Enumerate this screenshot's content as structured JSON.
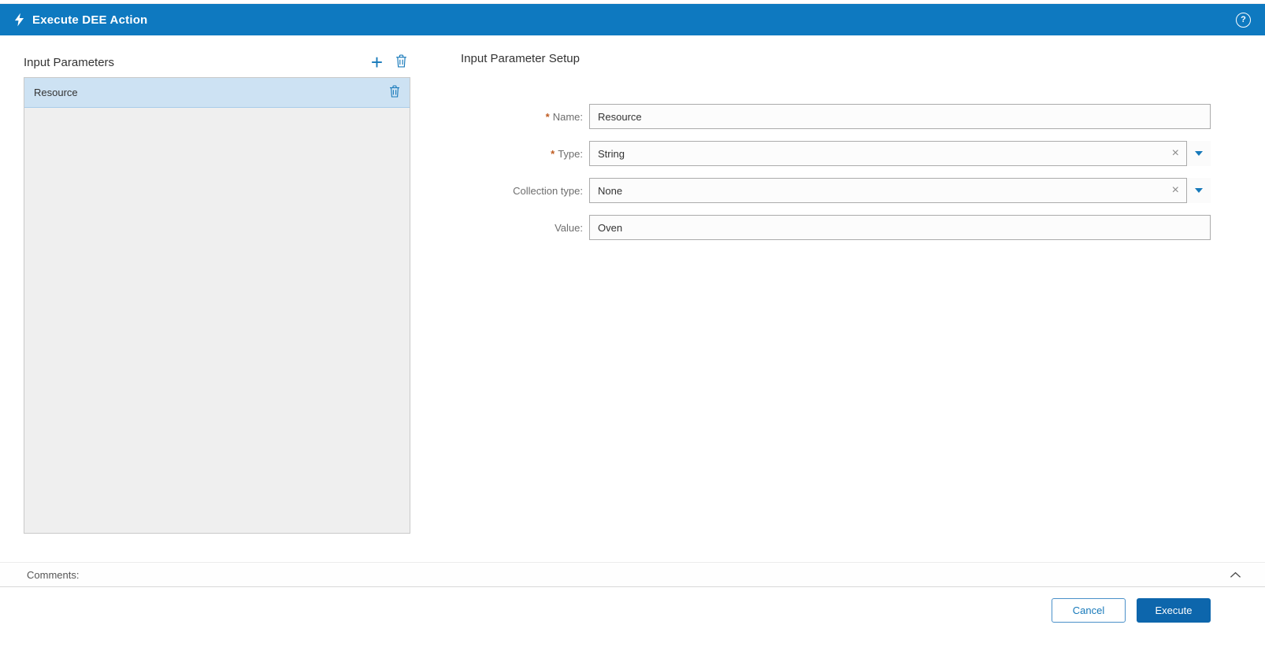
{
  "header": {
    "title": "Execute DEE Action"
  },
  "left_panel": {
    "title": "Input Parameters",
    "items": [
      {
        "label": "Resource",
        "selected": true
      }
    ]
  },
  "right_panel": {
    "title": "Input Parameter Setup",
    "fields": {
      "name": {
        "label": "Name:",
        "required_marker": "*",
        "value": "Resource"
      },
      "type": {
        "label": "Type:",
        "required_marker": "*",
        "value": "String"
      },
      "collection_type": {
        "label": "Collection type:",
        "value": "None"
      },
      "value": {
        "label": "Value:",
        "value": "Oven"
      }
    }
  },
  "comments": {
    "label": "Comments:"
  },
  "footer": {
    "cancel_label": "Cancel",
    "execute_label": "Execute"
  },
  "icons": {
    "help_glyph": "?",
    "add_glyph": "+",
    "clear_glyph": "×"
  },
  "colors": {
    "header_bg": "#0e79c0",
    "accent_blue": "#1779ba",
    "execute_bg": "#0d66ac",
    "required_asterisk": "#bf5b21",
    "selected_row_bg": "#cde2f3",
    "list_bg": "#efefef"
  }
}
